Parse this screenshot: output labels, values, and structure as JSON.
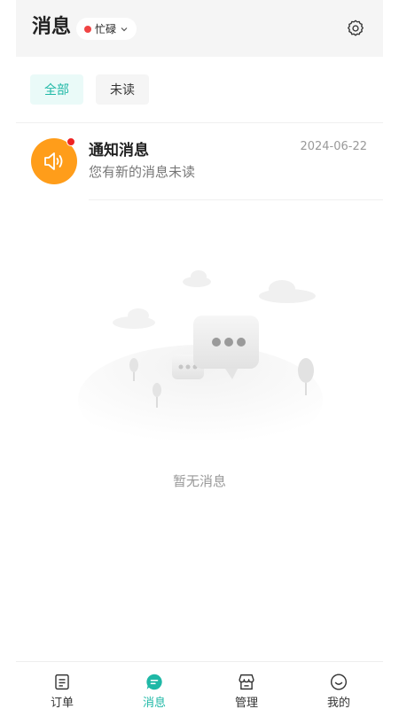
{
  "header": {
    "title": "消息",
    "status": {
      "label": "忙碌",
      "dot_color": "#f04444",
      "icon": "chevron-down-icon"
    },
    "settings_icon": "gear-icon"
  },
  "tabs": [
    {
      "label": "全部",
      "active": true
    },
    {
      "label": "未读",
      "active": false
    }
  ],
  "notices": [
    {
      "title": "通知消息",
      "subtitle": "您有新的消息未读",
      "date": "2024-06-22",
      "icon": "speaker-icon",
      "icon_bg": "#ff9d1a",
      "unread": true
    }
  ],
  "empty_state": {
    "text": "暂无消息",
    "icon": "chat-bubbles-illustration"
  },
  "bottom_nav": [
    {
      "label": "订单",
      "icon": "order-icon",
      "active": false
    },
    {
      "label": "消息",
      "icon": "message-icon",
      "active": true
    },
    {
      "label": "管理",
      "icon": "store-icon",
      "active": false
    },
    {
      "label": "我的",
      "icon": "smile-icon",
      "active": false
    }
  ],
  "colors": {
    "accent": "#1fb8a6",
    "warning": "#ff9d1a",
    "alert": "#ee2222"
  }
}
